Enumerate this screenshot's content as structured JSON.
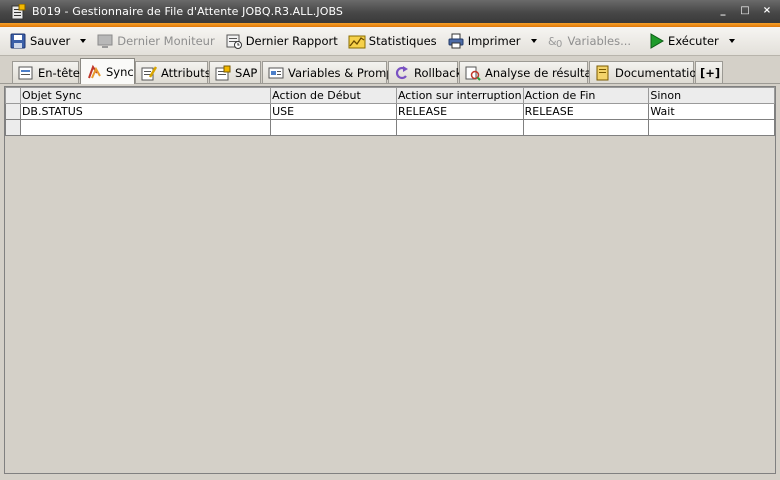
{
  "window": {
    "title": "B019 - Gestionnaire de File d'Attente JOBQ.R3.ALL.JOBS",
    "buttons": {
      "minimize": "_",
      "maximize": "□",
      "close": "×"
    }
  },
  "toolbar": {
    "save": "Sauver",
    "last_monitor": "Dernier Moniteur",
    "last_report": "Dernier Rapport",
    "statistics": "Statistiques",
    "print": "Imprimer",
    "variables": "Variables...",
    "execute": "Exécuter"
  },
  "tabs": [
    {
      "label": "En-tête",
      "icon": "header-icon"
    },
    {
      "label": "Sync",
      "icon": "sync-icon",
      "active": true
    },
    {
      "label": "Attributs",
      "icon": "attributes-icon"
    },
    {
      "label": "SAP",
      "icon": "sap-icon"
    },
    {
      "label": "Variables & Prompts",
      "icon": "variables-icon"
    },
    {
      "label": "Rollback",
      "icon": "rollback-icon"
    },
    {
      "label": "Analyse de résultats",
      "icon": "analysis-icon"
    },
    {
      "label": "Documentation",
      "icon": "documentation-icon"
    },
    {
      "label": "[+]",
      "icon": "add-tab-icon"
    }
  ],
  "table": {
    "columns": [
      "Objet Sync",
      "Action de Début",
      "Action sur interruption",
      "Action de Fin",
      "Sinon"
    ],
    "rows": [
      [
        "DB.STATUS",
        "USE",
        "RELEASE",
        "RELEASE",
        "Wait"
      ],
      [
        "",
        "",
        "",
        "",
        ""
      ]
    ]
  },
  "colors": {
    "titlebar": "#474747",
    "accent_strip": "#f08a1a",
    "background": "#d4d0c8"
  }
}
